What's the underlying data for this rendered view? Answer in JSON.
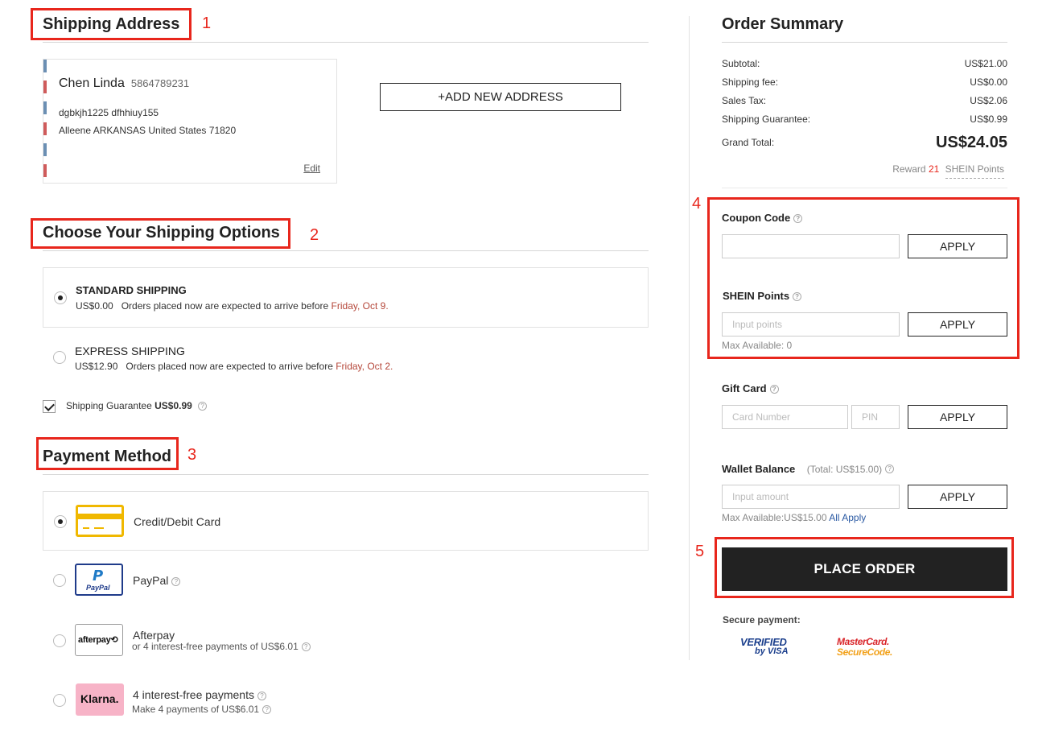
{
  "shipping_address": {
    "title": "Shipping Address",
    "annotation": "1",
    "name": "Chen Linda",
    "phone": "5864789231",
    "line1": "dgbkjh1225 dfhhiuy155",
    "line2": "Alleene ARKANSAS United States 71820",
    "edit_label": "Edit",
    "add_new_label": "+ADD NEW ADDRESS"
  },
  "shipping_options": {
    "title": "Choose Your Shipping Options",
    "annotation": "2",
    "standard": {
      "title": "STANDARD SHIPPING",
      "price": "US$0.00",
      "text": "Orders placed now are expected to arrive before",
      "date": "Friday, Oct 9.",
      "selected": true
    },
    "express": {
      "title": "EXPRESS SHIPPING",
      "price": "US$12.90",
      "text": "Orders placed now are expected to arrive before",
      "date": "Friday, Oct 2.",
      "selected": false
    },
    "guarantee_label": "Shipping Guarantee",
    "guarantee_price": "US$0.99",
    "guarantee_checked": true
  },
  "payment_method": {
    "title": "Payment Method",
    "annotation": "3",
    "options": [
      {
        "label": "Credit/Debit Card",
        "icon": "credit-card-icon",
        "selected": true
      },
      {
        "label": "PayPal",
        "icon": "paypal-logo",
        "selected": false
      },
      {
        "label": "Afterpay",
        "sub": "or 4 interest-free payments of US$6.01",
        "icon": "afterpay-logo",
        "selected": false
      },
      {
        "label": "4 interest-free payments",
        "sub": "Make 4 payments of US$6.01",
        "icon": "klarna-logo",
        "selected": false
      }
    ]
  },
  "order_summary": {
    "title": "Order Summary",
    "rows": [
      {
        "label": "Subtotal:",
        "value": "US$21.00"
      },
      {
        "label": "Shipping fee:",
        "value": "US$0.00"
      },
      {
        "label": "Sales Tax:",
        "value": "US$2.06"
      },
      {
        "label": "Shipping Guarantee:",
        "value": "US$0.99"
      }
    ],
    "grand_total_label": "Grand Total:",
    "grand_total_value": "US$24.05",
    "reward_prefix": "Reward",
    "reward_points": "21",
    "reward_suffix": "SHEIN Points"
  },
  "coupon": {
    "annotation": "4",
    "label": "Coupon Code",
    "apply_label": "APPLY"
  },
  "points": {
    "label": "SHEIN Points",
    "placeholder": "Input points",
    "apply_label": "APPLY",
    "max_available": "Max Available: 0"
  },
  "gift_card": {
    "label": "Gift Card",
    "card_placeholder": "Card Number",
    "pin_placeholder": "PIN",
    "apply_label": "APPLY"
  },
  "wallet": {
    "label": "Wallet Balance",
    "total": "(Total: US$15.00)",
    "placeholder": "Input amount",
    "apply_label": "APPLY",
    "max_available": "Max Available:US$15.00",
    "all_apply": "All Apply"
  },
  "place_order": {
    "annotation": "5",
    "label": "PLACE ORDER"
  },
  "secure_payment": {
    "label": "Secure payment:",
    "visa_line1": "VERIFIED",
    "visa_line2": "by VISA",
    "mc_line1": "MasterCard.",
    "mc_line2": "SecureCode."
  },
  "colors": {
    "annotation_red": "#e8261c",
    "date_red": "#b5473a",
    "place_order_bg": "#222222",
    "link_blue": "#2b5aa3"
  }
}
